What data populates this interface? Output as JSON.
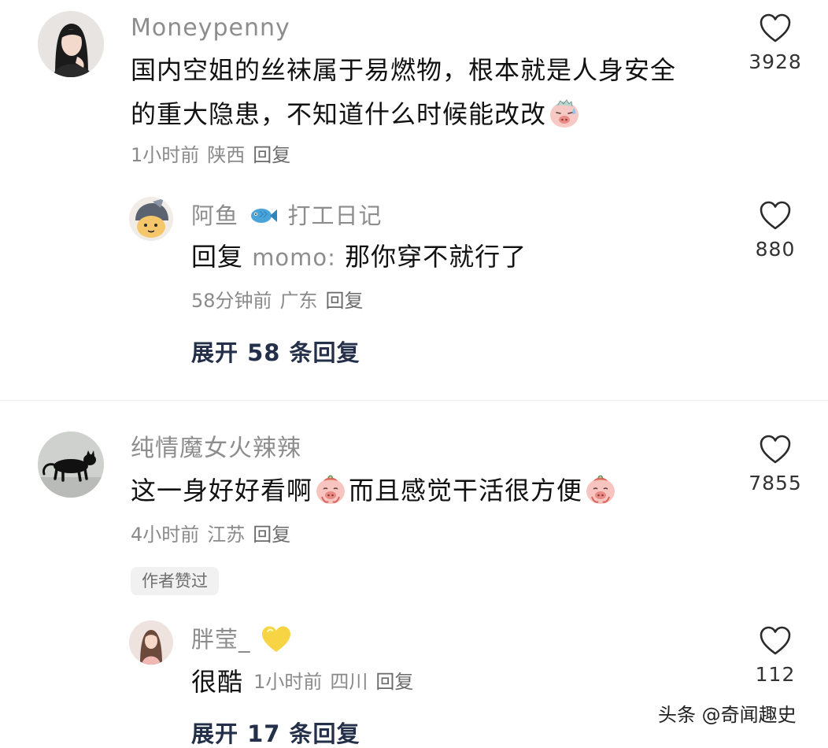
{
  "comments": [
    {
      "username": "Moneypenny",
      "text_line1": "国内空姐的丝袜属于易燃物，根本就是人身安全",
      "text_line2": "的重大隐患，不知道什么时候能改改",
      "time": "1小时前",
      "location": "陕西",
      "reply_label": "回复",
      "likes": "3928",
      "avatar_icon": "woman-avatar-icon",
      "emoji_icon": "sweating-pig-emoji-icon",
      "reply": {
        "username": "阿鱼",
        "badge_icon": "fish-icon",
        "username_suffix": "打工日记",
        "reply_prefix": "回复",
        "reply_to": "momo:",
        "text": "那你穿不就行了",
        "time": "58分钟前",
        "location": "广东",
        "reply_label": "回复",
        "likes": "880",
        "avatar_icon": "cartoon-avatar-icon"
      },
      "expand_label": "展开 58 条回复"
    },
    {
      "username": "纯情魔女火辣辣",
      "text_part1": "这一身好好看啊",
      "text_part2": "而且感觉干活很方便",
      "time": "4小时前",
      "location": "江苏",
      "reply_label": "回复",
      "likes": "7855",
      "avatar_icon": "black-cat-avatar-icon",
      "emoji_icon": "shy-pig-emoji-icon",
      "author_badge": "作者赞过",
      "reply": {
        "username": "胖莹_",
        "badge_icon": "yellow-heart-icon",
        "text": "很酷",
        "time": "1小时前",
        "location": "四川",
        "reply_label": "回复",
        "likes": "112",
        "avatar_icon": "girl-avatar-icon"
      },
      "expand_label": "展开 17 条回复"
    }
  ],
  "watermark": "头条 @奇闻趣史",
  "colors": {
    "username": "#8d8d8d",
    "text": "#111111",
    "meta": "#8a8a8a",
    "expand": "#24304a",
    "badge_bg": "#f1f1f2"
  }
}
